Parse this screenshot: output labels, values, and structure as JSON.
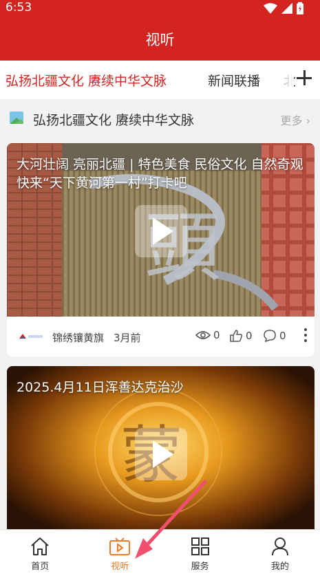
{
  "status_bar": {
    "time": "6:53"
  },
  "header": {
    "title": "视听"
  },
  "tabs": [
    {
      "label": "弘扬北疆文化  赓续中华文脉",
      "active": true
    },
    {
      "label": "新闻联播",
      "active": false
    },
    {
      "label": "北",
      "active": false
    }
  ],
  "section": {
    "title": "弘扬北疆文化  赓续中华文脉",
    "more_label": "更多 ›"
  },
  "videos": [
    {
      "caption": "大河壮阔  亮丽北疆  |  特色美食  民俗文化 自然奇观  快来“天下黄河第一村”打卡吧",
      "source": "锦绣镶黄旗",
      "time": "3月前",
      "views": "0",
      "likes": "0",
      "comments": "0"
    },
    {
      "caption": "2025.4月11日浑善达克治沙"
    }
  ],
  "bottom_nav": [
    {
      "label": "首页",
      "icon": "home-icon",
      "active": false
    },
    {
      "label": "视听",
      "icon": "video-icon",
      "active": true
    },
    {
      "label": "服务",
      "icon": "grid-icon",
      "active": false
    },
    {
      "label": "我的",
      "icon": "user-icon",
      "active": false
    }
  ],
  "colors": {
    "brand_red": "#d42420",
    "active_orange": "#f07b2a",
    "annotation_arrow": "#f0506e"
  }
}
